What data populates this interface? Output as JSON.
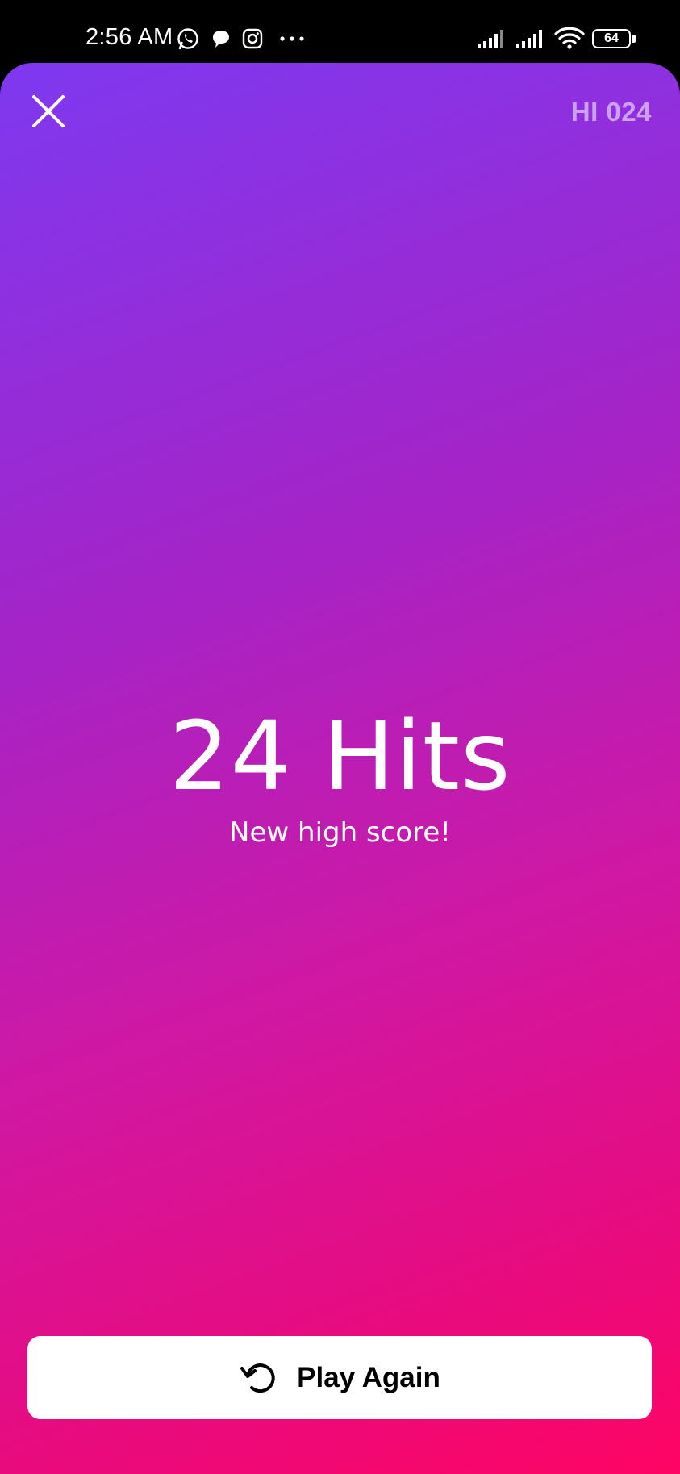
{
  "status_bar": {
    "time": "2:56 AM",
    "notification_icons": [
      "whatsapp-icon",
      "chat-bubble-icon",
      "instagram-icon",
      "more-dots-icon"
    ],
    "battery_level": "64"
  },
  "header": {
    "close_icon": "close-icon",
    "high_score_label": "HI 024"
  },
  "result": {
    "hits_text": "24 Hits",
    "message": "New high score!"
  },
  "actions": {
    "play_again_label": "Play Again",
    "play_again_icon": "replay-icon"
  },
  "colors": {
    "gradient_top": "#7e39f0",
    "gradient_bottom": "#fe0463",
    "button_bg": "#ffffff"
  }
}
